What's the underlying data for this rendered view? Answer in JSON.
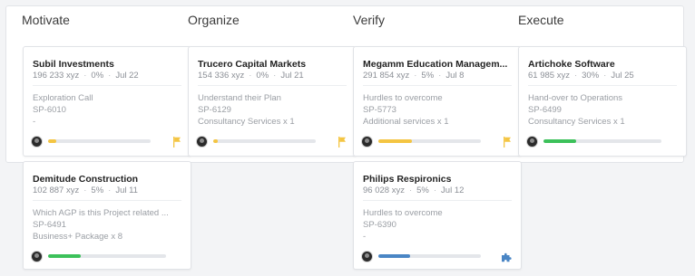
{
  "columns": [
    "Motivate",
    "Organize",
    "Verify",
    "Execute"
  ],
  "colors": {
    "yellow": "#f4c542",
    "green": "#3cc15a",
    "blue": "#4a86c5"
  },
  "cards": [
    {
      "title": "Subil Investments",
      "amount": "196 233 xyz",
      "percent": "0%",
      "date": "Jul 22",
      "line1": "Exploration Call",
      "line2": "SP-6010",
      "line3": "-",
      "progress": 0.08,
      "bar_color": "#f4c542",
      "trailing_icon": "flag-icon"
    },
    {
      "title": "Trucero Capital Markets",
      "amount": "154 336 xyz",
      "percent": "0%",
      "date": "Jul 21",
      "line1": "Understand their Plan",
      "line2": "SP-6129",
      "line3": "Consultancy Services x 1",
      "progress": 0.04,
      "bar_color": "#f4c542",
      "trailing_icon": "flag-icon"
    },
    {
      "title": "Megamm Education Managem...",
      "amount": "291 854 xyz",
      "percent": "5%",
      "date": "Jul 8",
      "line1": "Hurdles to overcome",
      "line2": "SP-5773",
      "line3": "Additional services x 1",
      "progress": 0.33,
      "bar_color": "#f4c542",
      "trailing_icon": "flag-icon"
    },
    {
      "title": "Artichoke Software",
      "amount": "61 985 xyz",
      "percent": "30%",
      "date": "Jul 25",
      "line1": "Hand-over to Operations",
      "line2": "SP-6499",
      "line3": "Consultancy Services x 1",
      "progress": 0.28,
      "bar_color": "#3cc15a",
      "trailing_icon": ""
    },
    {
      "title": "Demitude Construction",
      "amount": "102 887 xyz",
      "percent": "5%",
      "date": "Jul 11",
      "line1": "Which AGP is this Project related ...",
      "line2": "SP-6491",
      "line3": "Business+ Package x 8",
      "progress": 0.28,
      "bar_color": "#3cc15a",
      "trailing_icon": ""
    },
    {
      "title": "Philips Respironics",
      "amount": "96 028 xyz",
      "percent": "5%",
      "date": "Jul 12",
      "line1": "Hurdles to overcome",
      "line2": "SP-6390",
      "line3": "-",
      "progress": 0.31,
      "bar_color": "#4a86c5",
      "trailing_icon": "puzzle-icon"
    }
  ]
}
